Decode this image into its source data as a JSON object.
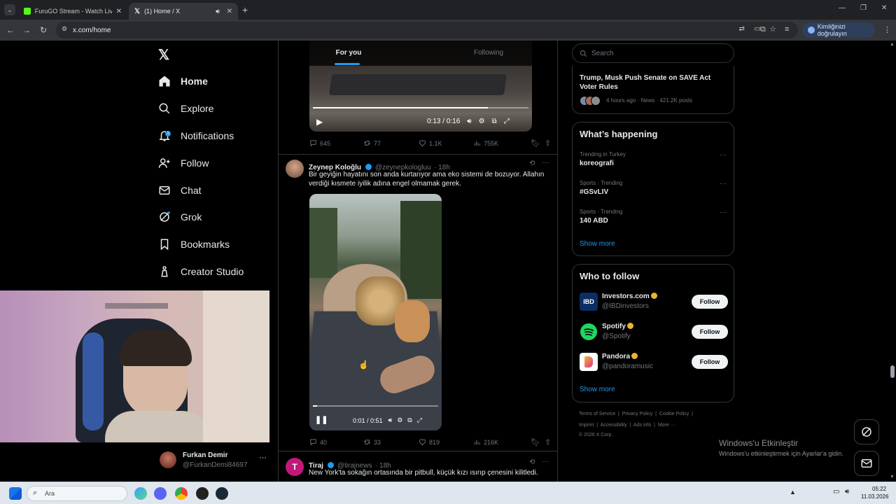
{
  "browser": {
    "tabs": [
      {
        "title": "FuruGO Stream - Watch Live or...",
        "active": false
      },
      {
        "title": "(1) Home / X",
        "active": true
      }
    ],
    "url": "x.com/home",
    "verify_label": "Kimliğinizi doğrulayın"
  },
  "nav": {
    "items": [
      {
        "label": "Home",
        "icon": "home-icon"
      },
      {
        "label": "Explore",
        "icon": "search-icon"
      },
      {
        "label": "Notifications",
        "icon": "bell-icon",
        "badge": "1"
      },
      {
        "label": "Follow",
        "icon": "person-plus-icon"
      },
      {
        "label": "Chat",
        "icon": "mail-icon"
      },
      {
        "label": "Grok",
        "icon": "grok-icon"
      },
      {
        "label": "Bookmarks",
        "icon": "bookmark-icon"
      },
      {
        "label": "Creator Studio",
        "icon": "creator-icon"
      }
    ],
    "account": {
      "name": "Furkan Demir",
      "handle": "@FurkanDemi84697"
    }
  },
  "feed": {
    "tabs": [
      "For you",
      "Following"
    ],
    "video1": {
      "time": "0:13 / 0:16"
    },
    "tweet1_metrics": {
      "replies": "645",
      "reposts": "77",
      "likes": "1.1K",
      "views": "755K"
    },
    "tweet2": {
      "name": "Zeynep Koloğlu",
      "handle": "@zeynepkologluu",
      "time": "· 18h",
      "text": "Bir geyiğin hayatını son anda kurtarıyor ama eko sistemi de bozuyor. Allahın verdiği kısmete iyilik adına engel olmamak gerek.",
      "video_time": "0:01 / 0:51",
      "metrics": {
        "replies": "40",
        "reposts": "33",
        "likes": "819",
        "views": "216K"
      }
    },
    "tweet3": {
      "name": "Tiraj",
      "handle": "@tirajnews",
      "time": "· 18h",
      "text": "New York'ta sokağın ortasında bir pitbull, küçük kızı ısırıp çenesini kilitledi."
    }
  },
  "right": {
    "search_placeholder": "Search",
    "news": {
      "title": "Trump, Musk Push Senate on SAVE Act Voter Rules",
      "meta": "4 hours ago · News · 421.2K posts"
    },
    "happening": {
      "title": "What’s happening",
      "trends": [
        {
          "context": "Trending in Turkey",
          "name": "koreografi"
        },
        {
          "context": "Sports · Trending",
          "name": "#GSvLIV"
        },
        {
          "context": "Sports · Trending",
          "name": "140 ABD"
        }
      ],
      "show_more": "Show more"
    },
    "who_to_follow": {
      "title": "Who to follow",
      "accounts": [
        {
          "name": "Investors.com",
          "handle": "@IBDinvestors",
          "button": "Follow",
          "avatar_text": "IBD"
        },
        {
          "name": "Spotify",
          "handle": "@Spotify",
          "button": "Follow"
        },
        {
          "name": "Pandora",
          "handle": "@pandoramusic",
          "button": "Follow"
        }
      ],
      "show_more": "Show more"
    },
    "footer": {
      "line1": "Terms of Service  |  Privacy Policy  |  Cookie Policy  |",
      "line2": "Imprint  |  Accessibility  |  Ads info  |  More ···",
      "line3": "© 2026 X Corp."
    }
  },
  "windows_watermark": {
    "title": "Windows'u Etkinleştir",
    "subtitle": "Windows'u etkinleştirmek için Ayarlar'a gidin."
  },
  "taskbar": {
    "search_placeholder": "Ara",
    "time": "05:22",
    "date": "11.03.2026"
  }
}
